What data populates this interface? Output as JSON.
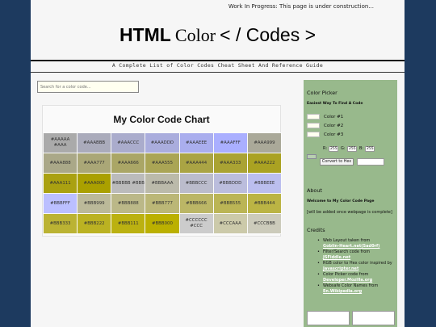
{
  "notice": "Work In Progress: This page is under construction...",
  "header": {
    "html_word": "HTML",
    "color_word": "Color",
    "codes_part": "< / Codes >",
    "subtitle": "A Complete List of Color Codes Cheat Sheet And Reference Guide"
  },
  "search": {
    "placeholder": "Search for a color code..."
  },
  "chart": {
    "title": "My Color Code Chart",
    "rows": [
      [
        {
          "text": "#AAAAA #AAA",
          "bg": "#aaaaaa"
        },
        {
          "text": "#AAABBB",
          "bg": "#aaabbb"
        },
        {
          "text": "#AAACCC",
          "bg": "#aaaccc"
        },
        {
          "text": "#AAADDD",
          "bg": "#aaaddd"
        },
        {
          "text": "#AAAEEE",
          "bg": "#aaaeee"
        },
        {
          "text": "#AAAFFF",
          "bg": "#aaafff"
        },
        {
          "text": "#AAA999",
          "bg": "#aaa999"
        }
      ],
      [
        {
          "text": "#AAA888",
          "bg": "#aaa888"
        },
        {
          "text": "#AAA777",
          "bg": "#aaa777"
        },
        {
          "text": "#AAA666",
          "bg": "#aaa666"
        },
        {
          "text": "#AAA555",
          "bg": "#aaa555"
        },
        {
          "text": "#AAA444",
          "bg": "#aaa444"
        },
        {
          "text": "#AAA333",
          "bg": "#aaa333"
        },
        {
          "text": "#AAA222",
          "bg": "#aaa222"
        }
      ],
      [
        {
          "text": "#AAA111",
          "bg": "#aaa111"
        },
        {
          "text": "#AAA000",
          "bg": "#aaa000"
        },
        {
          "text": "#BBBBB #BBB",
          "bg": "#bbbbbb"
        },
        {
          "text": "#BBBAAA",
          "bg": "#bbbaaa"
        },
        {
          "text": "#BBBCCC",
          "bg": "#bbbccc"
        },
        {
          "text": "#BBBDDD",
          "bg": "#bbbddd"
        },
        {
          "text": "#BBBEEE",
          "bg": "#bbbeee"
        }
      ],
      [
        {
          "text": "#BBBFFF",
          "bg": "#bbbfff"
        },
        {
          "text": "#BBB999",
          "bg": "#bbb999"
        },
        {
          "text": "#BBB888",
          "bg": "#bbb888"
        },
        {
          "text": "#BBB777",
          "bg": "#bbb777"
        },
        {
          "text": "#BBB666",
          "bg": "#bbb666"
        },
        {
          "text": "#BBB555",
          "bg": "#bbb555"
        },
        {
          "text": "#BBB444",
          "bg": "#bbb444"
        }
      ],
      [
        {
          "text": "#BBB333",
          "bg": "#bbb333"
        },
        {
          "text": "#BBB222",
          "bg": "#bbb222"
        },
        {
          "text": "#BBB111",
          "bg": "#bbb111"
        },
        {
          "text": "#BBB000",
          "bg": "#bbb000"
        },
        {
          "text": "#CCCCCC #CCC",
          "bg": "#cccccc"
        },
        {
          "text": "#CCCAAA",
          "bg": "#cccaaa"
        },
        {
          "text": "#CCCBBB",
          "bg": "#cccbbb"
        }
      ]
    ]
  },
  "sidebar": {
    "picker_title": "Color Picker",
    "picker_subtitle": "Easiest Way To Find A Code",
    "colors": [
      "Color #1",
      "Color #2",
      "Color #3"
    ],
    "r_label": "R:",
    "g_label": "G:",
    "b_label": "B:",
    "r_value": "255",
    "g_value": "255",
    "b_value": "255",
    "convert_label": "Convert to Hex",
    "about_title": "About",
    "about_welcome": "Welcome to My Color Code Page",
    "about_note": "[will be added once webpage is complete]",
    "credits_title": "Credits",
    "credits": [
      {
        "text": "Web Layout taken from",
        "link": "Goblin-Heart.net(Sad0rf)"
      },
      {
        "text": "Filter/Search code from",
        "link": "JSFiddle.net"
      },
      {
        "text": "RGB color to Hex color inspired by",
        "link": "Javascripter.net"
      },
      {
        "text": "Color Picker code from",
        "link": "Developer.Mozilla.org"
      },
      {
        "text": "Websafe Color Names from",
        "link": "En.Wikipedia.org"
      }
    ]
  }
}
